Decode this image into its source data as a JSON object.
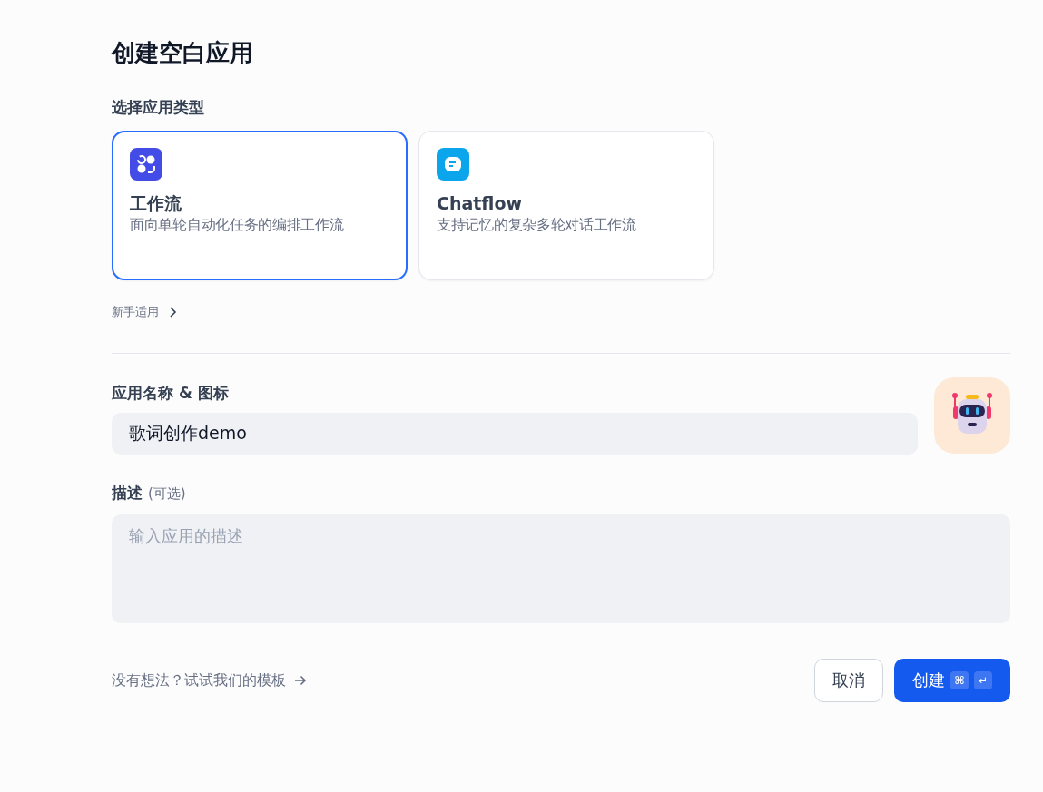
{
  "title": "创建空白应用",
  "app_type": {
    "label": "选择应用类型",
    "options": [
      {
        "kind": "workflow",
        "name": "工作流",
        "description": "面向单轮自动化任务的编排工作流",
        "selected": true
      },
      {
        "kind": "chatflow",
        "name": "Chatflow",
        "description": "支持记忆的复杂多轮对话工作流",
        "selected": false
      }
    ],
    "beginner_link": "新手适用"
  },
  "name_field": {
    "label": "应用名称 & 图标",
    "value": "歌词创作demo"
  },
  "description_field": {
    "label": "描述",
    "optional": "(可选)",
    "placeholder": "输入应用的描述"
  },
  "footer": {
    "template_link": "没有想法？试试我们的模板",
    "buttons": [
      {
        "kind": "secondary",
        "label": "取消"
      },
      {
        "kind": "primary",
        "label": "创建",
        "shortcut_keys": [
          "⌘",
          "↵"
        ]
      }
    ]
  }
}
